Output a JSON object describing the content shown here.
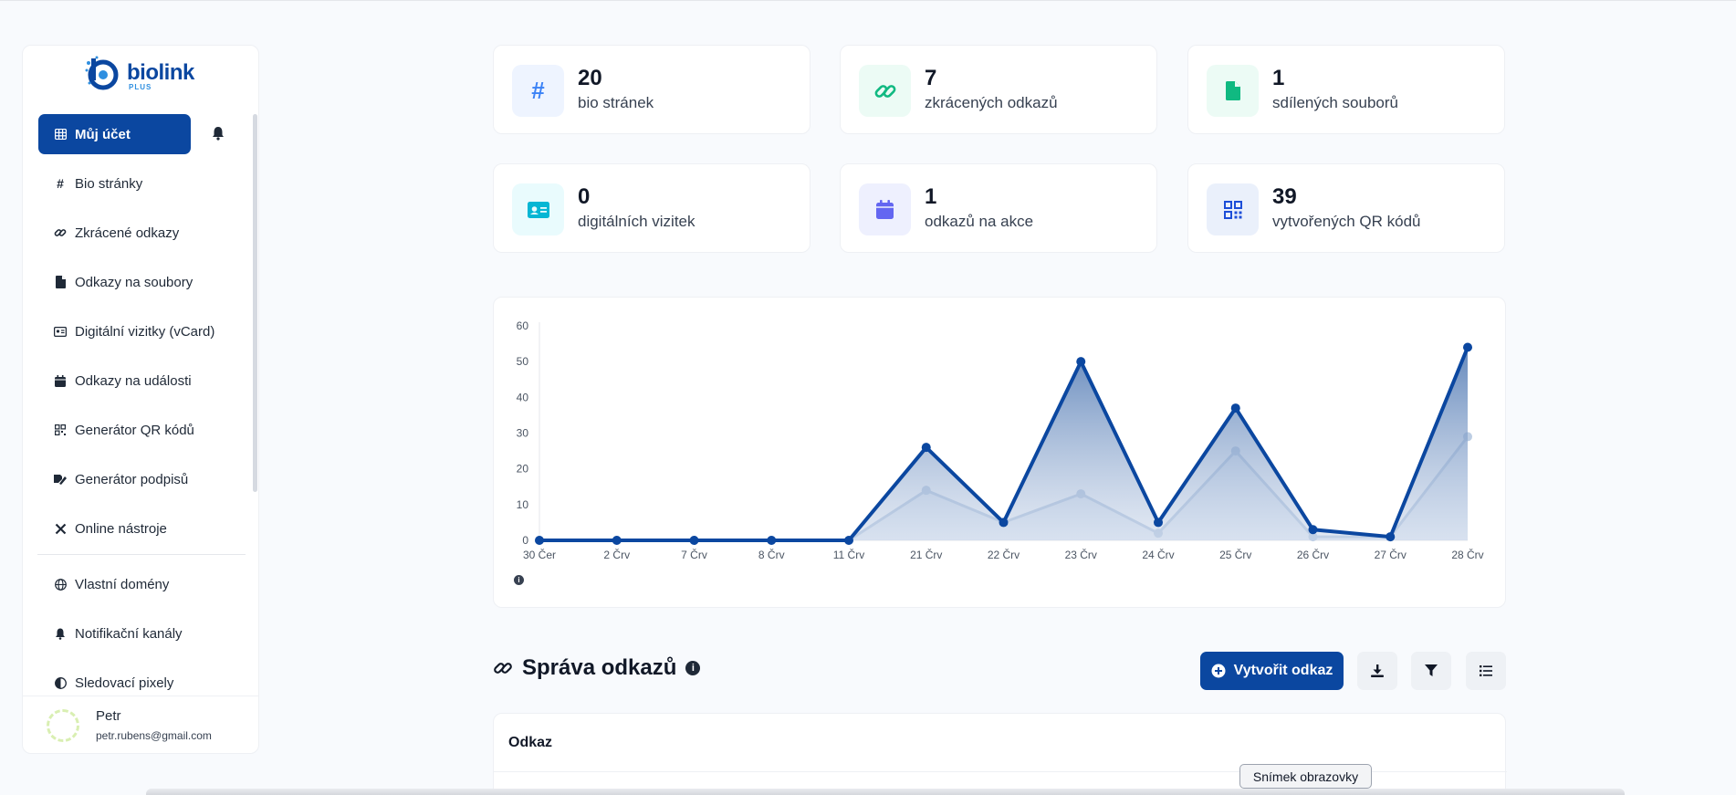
{
  "brand": {
    "name": "biolink",
    "sub": "PLUS"
  },
  "sidebar": {
    "active": {
      "label": "Můj účet",
      "icon": "table-icon"
    },
    "items": [
      {
        "label": "Bio stránky",
        "icon": "hash-icon"
      },
      {
        "label": "Zkrácené odkazy",
        "icon": "link-icon"
      },
      {
        "label": "Odkazy na soubory",
        "icon": "file-icon"
      },
      {
        "label": "Digitální vizitky (vCard)",
        "icon": "id-card-icon"
      },
      {
        "label": "Odkazy na události",
        "icon": "calendar-icon"
      },
      {
        "label": "Generátor QR kódů",
        "icon": "qrcode-icon"
      },
      {
        "label": "Generátor podpisů",
        "icon": "signature-icon"
      },
      {
        "label": "Online nástroje",
        "icon": "tools-icon"
      },
      {
        "label": "Vlastní domény",
        "icon": "globe-icon"
      },
      {
        "label": "Notifikační kanály",
        "icon": "bell-icon"
      },
      {
        "label": "Sledovací pixely",
        "icon": "adjust-icon"
      }
    ],
    "user": {
      "name": "Petr",
      "email": "petr.rubens@gmail.com"
    }
  },
  "stats": [
    {
      "value": "20",
      "label": "bio stránek",
      "icon": "hash-icon",
      "color": "#3b82f6",
      "bg": "#eef4ff"
    },
    {
      "value": "7",
      "label": "zkrácených odkazů",
      "icon": "link-icon",
      "color": "#10b981",
      "bg": "#ecfbf5"
    },
    {
      "value": "1",
      "label": "sdílených souborů",
      "icon": "file-icon",
      "color": "#10b981",
      "bg": "#ecfbf5"
    },
    {
      "value": "0",
      "label": "digitálních vizitek",
      "icon": "id-card-icon",
      "color": "#06b6d4",
      "bg": "#e9fbfd"
    },
    {
      "value": "1",
      "label": "odkazů na akce",
      "icon": "calendar-icon",
      "color": "#6366f1",
      "bg": "#eef0fe"
    },
    {
      "value": "39",
      "label": "vytvořených QR kódů",
      "icon": "qrcode-icon",
      "color": "#1d4ed8",
      "bg": "#eaf0fb"
    }
  ],
  "chart_data": {
    "type": "area",
    "categories": [
      "30 Čer",
      "2 Črv",
      "7 Črv",
      "8 Črv",
      "11 Črv",
      "21 Črv",
      "22 Črv",
      "23 Črv",
      "24 Črv",
      "25 Črv",
      "26 Črv",
      "27 Črv",
      "28 Črv"
    ],
    "series": [
      {
        "values": [
          0,
          0,
          0,
          0,
          0,
          26,
          5,
          50,
          5,
          37,
          3,
          1,
          54
        ],
        "color": "#0b47a0"
      },
      {
        "values": [
          0,
          0,
          0,
          0,
          0,
          14,
          5,
          13,
          2,
          25,
          1,
          1,
          29
        ],
        "color": "#bccde3"
      }
    ],
    "yticks": [
      0,
      10,
      20,
      30,
      40,
      50,
      60
    ],
    "ylim": [
      0,
      60
    ]
  },
  "links_section": {
    "title": "Správa odkazů",
    "create_label": "Vytvořit odkaz",
    "table_header": "Odkaz"
  },
  "tooltip": "Snímek obrazovky"
}
